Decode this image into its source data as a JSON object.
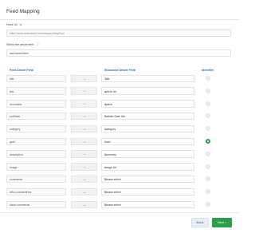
{
  "modal": {
    "title": "Feed Mapping",
    "feed_url_label": "Feed Url",
    "feed_url_value": "https://www.dnainclass.com/category/blog/feed",
    "select_label": "Select the article item",
    "select_value": "rss/channel/item"
  },
  "columns": {
    "source": "Feed Article Field",
    "target": "Showcase Article Field",
    "identifier": "Identifier"
  },
  "rows": [
    {
      "source": "title",
      "target": "Title",
      "identifier": false
    },
    {
      "source": "link",
      "target": "Article Url",
      "identifier": false
    },
    {
      "source": "dc:creator",
      "target": "Author",
      "identifier": false
    },
    {
      "source": "pubDate",
      "target": "Publish Date Utc",
      "identifier": false
    },
    {
      "source": "category",
      "target": "Category",
      "identifier": false
    },
    {
      "source": "guid",
      "target": "Guid",
      "identifier": true
    },
    {
      "source": "description",
      "target": "Summary",
      "identifier": false
    },
    {
      "source": "image",
      "target": "Image Url",
      "identifier": false
    },
    {
      "source": "comments",
      "target": "Please select",
      "identifier": false
    },
    {
      "source": "wfw:commentRss",
      "target": "Please select",
      "identifier": false
    },
    {
      "source": "slash:comments",
      "target": "Please select",
      "identifier": false
    }
  ],
  "footer": {
    "back_label": "Back",
    "next_label": "Next"
  },
  "icons": {
    "arrow": "right-arrow-icon",
    "caret": "chevron-down-icon",
    "info": "info-icon",
    "copy": "copy-icon"
  },
  "colors": {
    "accent_blue": "#1b6fb8",
    "primary_green": "#2e9b4d"
  }
}
